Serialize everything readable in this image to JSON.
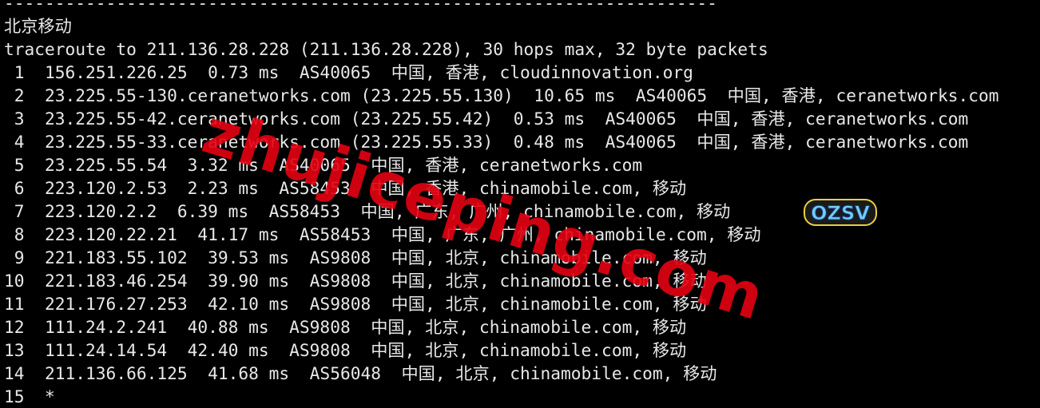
{
  "terminal": {
    "separator": "----------------------------------------------------------------------",
    "section_title": "北京移动",
    "command_line": "traceroute to 211.136.28.228 (211.136.28.228), 30 hops max, 32 byte packets",
    "hops": [
      " 1  156.251.226.25  0.73 ms  AS40065  中国, 香港, cloudinnovation.org",
      " 2  23.225.55-130.ceranetworks.com (23.225.55.130)  10.65 ms  AS40065  中国, 香港, ceranetworks.com",
      " 3  23.225.55-42.ceranetworks.com (23.225.55.42)  0.53 ms  AS40065  中国, 香港, ceranetworks.com",
      " 4  23.225.55-33.ceranetworks.com (23.225.55.33)  0.48 ms  AS40065  中国, 香港, ceranetworks.com",
      " 5  23.225.55.54  3.32 ms  AS40065  中国, 香港, ceranetworks.com",
      " 6  223.120.2.53  2.23 ms  AS58453  中国, 香港, chinamobile.com, 移动",
      " 7  223.120.2.2  6.39 ms  AS58453  中国, 广东, 广州, chinamobile.com, 移动",
      " 8  223.120.22.21  41.17 ms  AS58453  中国, 广东, 广州, chinamobile.com, 移动",
      " 9  221.183.55.102  39.53 ms  AS9808  中国, 北京, chinamobile.com, 移动",
      "10  221.183.46.254  39.90 ms  AS9808  中国, 北京, chinamobile.com, 移动",
      "11  221.176.27.253  42.10 ms  AS9808  中国, 北京, chinamobile.com, 移动",
      "12  111.24.2.241  40.88 ms  AS9808  中国, 北京, chinamobile.com, 移动",
      "13  111.24.14.54  42.40 ms  AS9808  中国, 北京, chinamobile.com, 移动",
      "14  211.136.66.125  41.68 ms  AS56048  中国, 北京, chinamobile.com, 移动",
      "15  *"
    ]
  },
  "watermark": {
    "text": "zhujiceping.com",
    "color": "#e60012"
  },
  "logo": {
    "text": "OZSV",
    "fill_color": "#6fd0f0",
    "outline_color": "#e8d040"
  }
}
